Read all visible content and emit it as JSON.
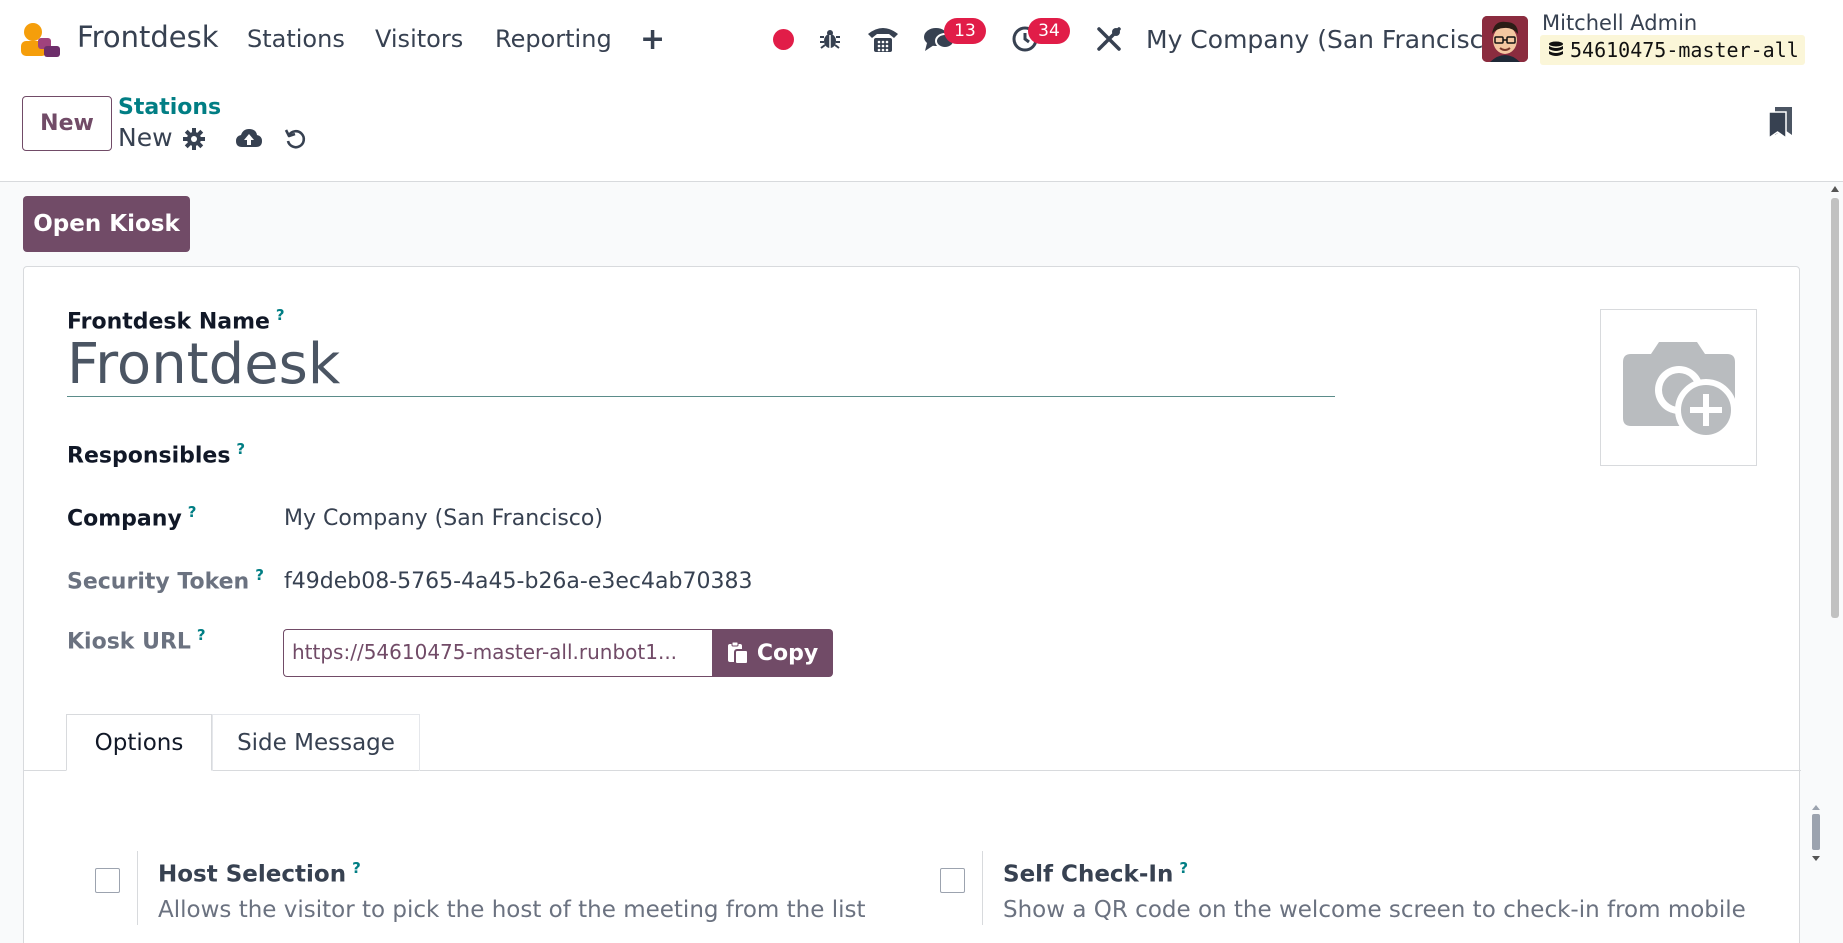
{
  "navbar": {
    "app_name": "Frontdesk",
    "menus": [
      "Stations",
      "Visitors",
      "Reporting"
    ],
    "plus": "+",
    "messages_badge": "13",
    "activities_badge": "34",
    "company": "My Company (San Francisco)",
    "user_name": "Mitchell Admin",
    "database": "54610475-master-all"
  },
  "control_panel": {
    "new_button": "New",
    "breadcrumb_parent": "Stations",
    "breadcrumb_current": "New"
  },
  "form": {
    "open_kiosk_button": "Open Kiosk",
    "name_label": "Frontdesk Name",
    "name_value": "Frontdesk",
    "responsibles_label": "Responsibles",
    "company_label": "Company",
    "company_value": "My Company (San Francisco)",
    "token_label": "Security Token",
    "token_value": "f49deb08-5765-4a45-b26a-e3ec4ab70383",
    "kiosk_url_label": "Kiosk URL",
    "kiosk_url_value": "https://54610475-master-all.runbot1...",
    "copy_button": "Copy",
    "help_mark": "?"
  },
  "tabs": [
    "Options",
    "Side Message"
  ],
  "options": {
    "host_selection": {
      "title": "Host Selection",
      "description": "Allows the visitor to pick the host of the meeting from the list"
    },
    "self_checkin": {
      "title": "Self Check-In",
      "description": "Show a QR code on the welcome screen to check-in from mobile"
    }
  },
  "colors": {
    "brand": "#714b67",
    "link": "#017e84",
    "badge": "#e11d48"
  }
}
